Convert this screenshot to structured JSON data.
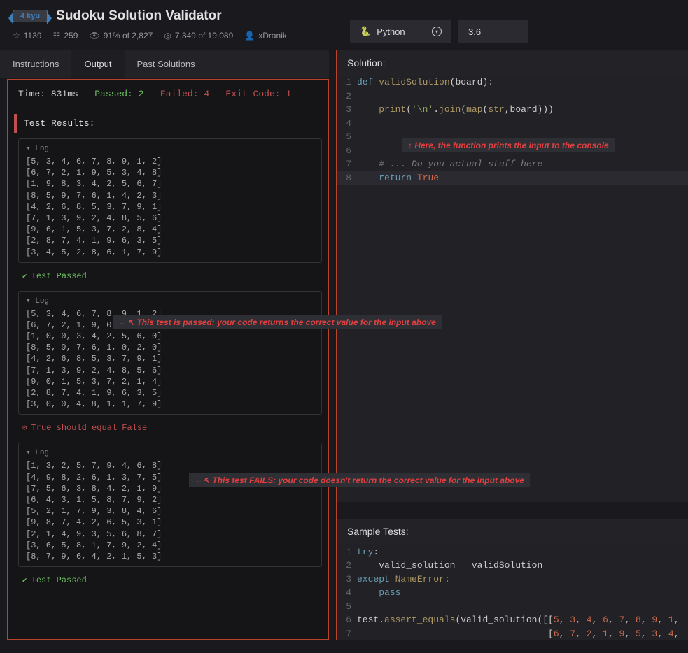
{
  "header": {
    "kyu": "4 kyu",
    "title": "Sudoku Solution Validator",
    "stats": {
      "stars": "1139",
      "collections": "259",
      "satisfaction": "91% of 2,827",
      "completed": "7,349 of 19,089",
      "author": "xDranik"
    },
    "language": "Python",
    "version": "3.6"
  },
  "tabs": {
    "instructions": "Instructions",
    "output": "Output",
    "past": "Past Solutions"
  },
  "status": {
    "time_label": "Time:",
    "time": "831ms",
    "passed_label": "Passed:",
    "passed": "2",
    "failed_label": "Failed:",
    "failed": "4",
    "exit_label": "Exit Code:",
    "exit": "1"
  },
  "results": {
    "header": "Test Results:",
    "log_label": "Log",
    "logs": [
      "[5, 3, 4, 6, 7, 8, 9, 1, 2]\n[6, 7, 2, 1, 9, 5, 3, 4, 8]\n[1, 9, 8, 3, 4, 2, 5, 6, 7]\n[8, 5, 9, 7, 6, 1, 4, 2, 3]\n[4, 2, 6, 8, 5, 3, 7, 9, 1]\n[7, 1, 3, 9, 2, 4, 8, 5, 6]\n[9, 6, 1, 5, 3, 7, 2, 8, 4]\n[2, 8, 7, 4, 1, 9, 6, 3, 5]\n[3, 4, 5, 2, 8, 6, 1, 7, 9]",
      "[5, 3, 4, 6, 7, 8, 9, 1, 2]\n[6, 7, 2, 1, 9, 0, 3, 4, 9]\n[1, 0, 0, 3, 4, 2, 5, 6, 0]\n[8, 5, 9, 7, 6, 1, 0, 2, 0]\n[4, 2, 6, 8, 5, 3, 7, 9, 1]\n[7, 1, 3, 9, 2, 4, 8, 5, 6]\n[9, 0, 1, 5, 3, 7, 2, 1, 4]\n[2, 8, 7, 4, 1, 9, 6, 3, 5]\n[3, 0, 0, 4, 8, 1, 1, 7, 9]",
      "[1, 3, 2, 5, 7, 9, 4, 6, 8]\n[4, 9, 8, 2, 6, 1, 3, 7, 5]\n[7, 5, 6, 3, 8, 4, 2, 1, 9]\n[6, 4, 3, 1, 5, 8, 7, 9, 2]\n[5, 2, 1, 7, 9, 3, 8, 4, 6]\n[9, 8, 7, 4, 2, 6, 5, 3, 1]\n[2, 1, 4, 9, 3, 5, 6, 8, 7]\n[3, 6, 5, 8, 1, 7, 9, 2, 4]\n[8, 7, 9, 6, 4, 2, 1, 5, 3]"
    ],
    "pass_text": "Test Passed",
    "fail_text": "True should equal False"
  },
  "annotations": {
    "a1": "↑ Here, the function prints the input to the console",
    "a2": "←↖ This test is passed: your code returns the correct value for the input above",
    "a3": "←↖ This test FAILS:  your code doesn't return the correct value for the input above"
  },
  "solution": {
    "header": "Solution:",
    "lines": [
      {
        "n": "1",
        "html": "<span class='kw'>def</span> <span class='fn'>validSolution</span>(board):"
      },
      {
        "n": "2",
        "html": ""
      },
      {
        "n": "3",
        "html": "    <span class='fn'>print</span>(<span class='str'>'\\n'</span>.<span class='fn'>join</span>(<span class='fn'>map</span>(<span class='fn'>str</span>,board)))"
      },
      {
        "n": "4",
        "html": ""
      },
      {
        "n": "5",
        "html": ""
      },
      {
        "n": "6",
        "html": ""
      },
      {
        "n": "7",
        "html": "    <span class='cm'># ... Do you actual stuff here</span>"
      },
      {
        "n": "8",
        "html": "    <span class='kw'>return</span> <span class='bool'>True</span>",
        "hl": true
      }
    ]
  },
  "sample": {
    "header": "Sample Tests:",
    "lines": [
      {
        "n": "1",
        "html": "<span class='kw'>try</span>:"
      },
      {
        "n": "2",
        "html": "    valid_solution = validSolution"
      },
      {
        "n": "3",
        "html": "<span class='kw'>except</span> <span class='fn'>NameError</span>:"
      },
      {
        "n": "4",
        "html": "    <span class='kw'>pass</span>"
      },
      {
        "n": "5",
        "html": ""
      },
      {
        "n": "6",
        "html": "test.<span class='fn'>assert_equals</span>(valid_solution([[<span class='num'>5</span>, <span class='num'>3</span>, <span class='num'>4</span>, <span class='num'>6</span>, <span class='num'>7</span>, <span class='num'>8</span>, <span class='num'>9</span>, <span class='num'>1</span>,"
      },
      {
        "n": "7",
        "html": "                                   [<span class='num'>6</span>, <span class='num'>7</span>, <span class='num'>2</span>, <span class='num'>1</span>, <span class='num'>9</span>, <span class='num'>5</span>, <span class='num'>3</span>, <span class='num'>4</span>,"
      }
    ]
  }
}
